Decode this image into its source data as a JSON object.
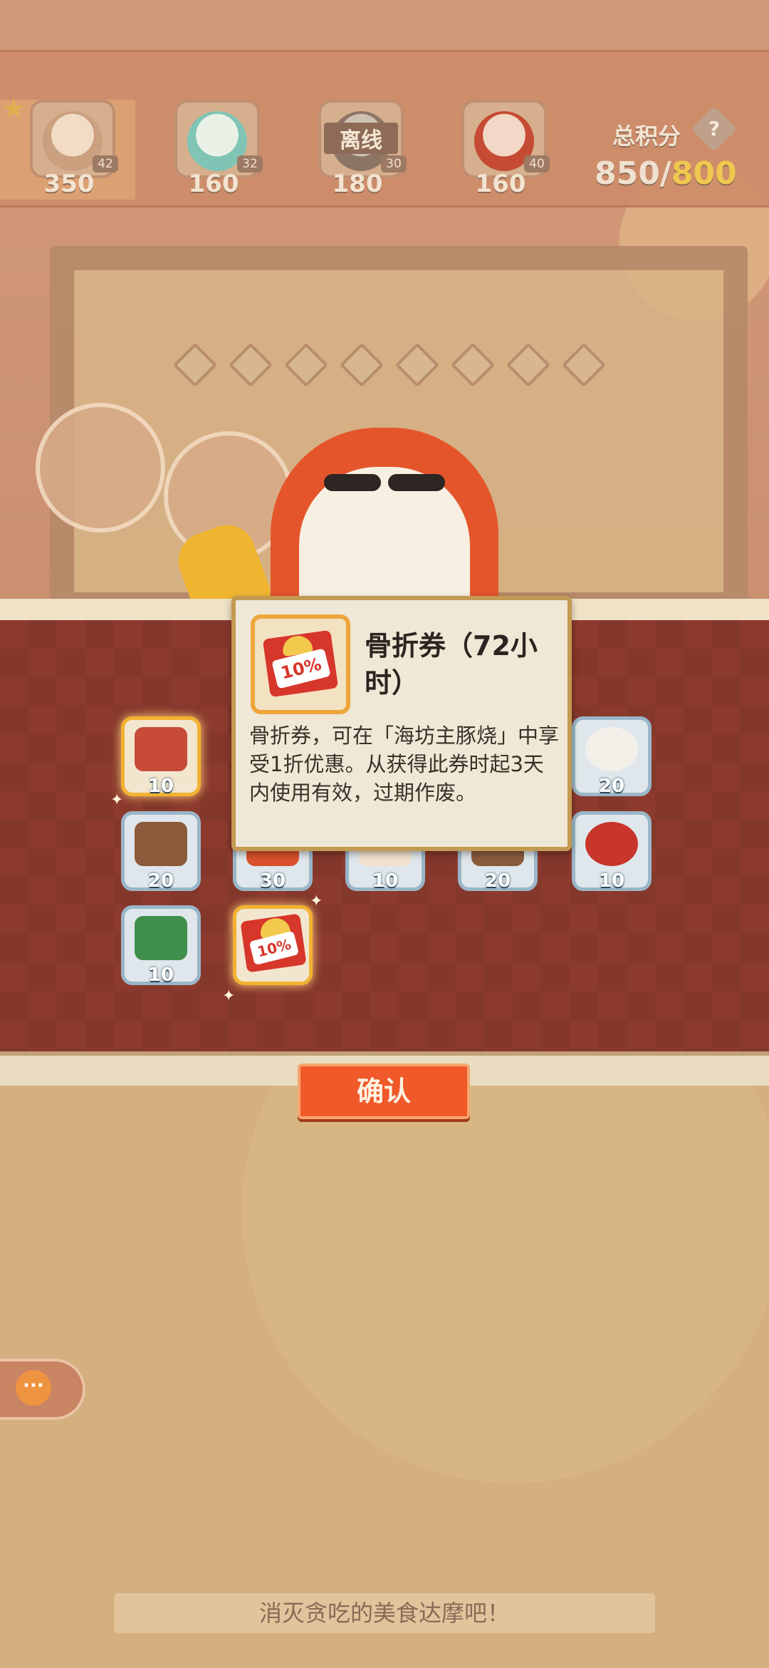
{
  "players": [
    {
      "score": "350",
      "level": "42",
      "status": ""
    },
    {
      "score": "160",
      "level": "32",
      "status": ""
    },
    {
      "score": "180",
      "level": "30",
      "status": "离线"
    },
    {
      "score": "160",
      "level": "40",
      "status": ""
    }
  ],
  "total": {
    "label": "总积分",
    "help": "?",
    "current": "850/",
    "goal": "800"
  },
  "rewards": [
    {
      "count": "10",
      "icon": "sauce-icon",
      "color": "#c84b3a",
      "highlight": true
    },
    {
      "count": "20",
      "icon": "rice-ball-icon",
      "color": "#f3f0ea",
      "highlight": false
    },
    {
      "count": "20",
      "icon": "shrimp-icon",
      "color": "#8b5a3a",
      "highlight": false
    },
    {
      "count": "30",
      "icon": "lobster-icon",
      "color": "#d9502d",
      "highlight": false
    },
    {
      "count": "10",
      "icon": "tofu-icon",
      "color": "#f1e2cc",
      "highlight": false
    },
    {
      "count": "20",
      "icon": "seaweed-icon",
      "color": "#8a5b3b",
      "highlight": false
    },
    {
      "count": "10",
      "icon": "noodle-bowl-icon",
      "color": "#c9352a",
      "highlight": false
    },
    {
      "count": "10",
      "icon": "scallion-icon",
      "color": "#3f8f4a",
      "highlight": false
    }
  ],
  "coupon_item": {
    "pct": "10%"
  },
  "tooltip": {
    "title": "骨折券（72小时）",
    "description": "骨折券，可在「海坊主豚烧」中享受1折优惠。从获得此券时起3天内使用有效，过期作废。",
    "pct": "10%"
  },
  "confirm_label": "确认",
  "chat_icon": "···",
  "hint": "消灭贪吃的美食达摩吧！"
}
